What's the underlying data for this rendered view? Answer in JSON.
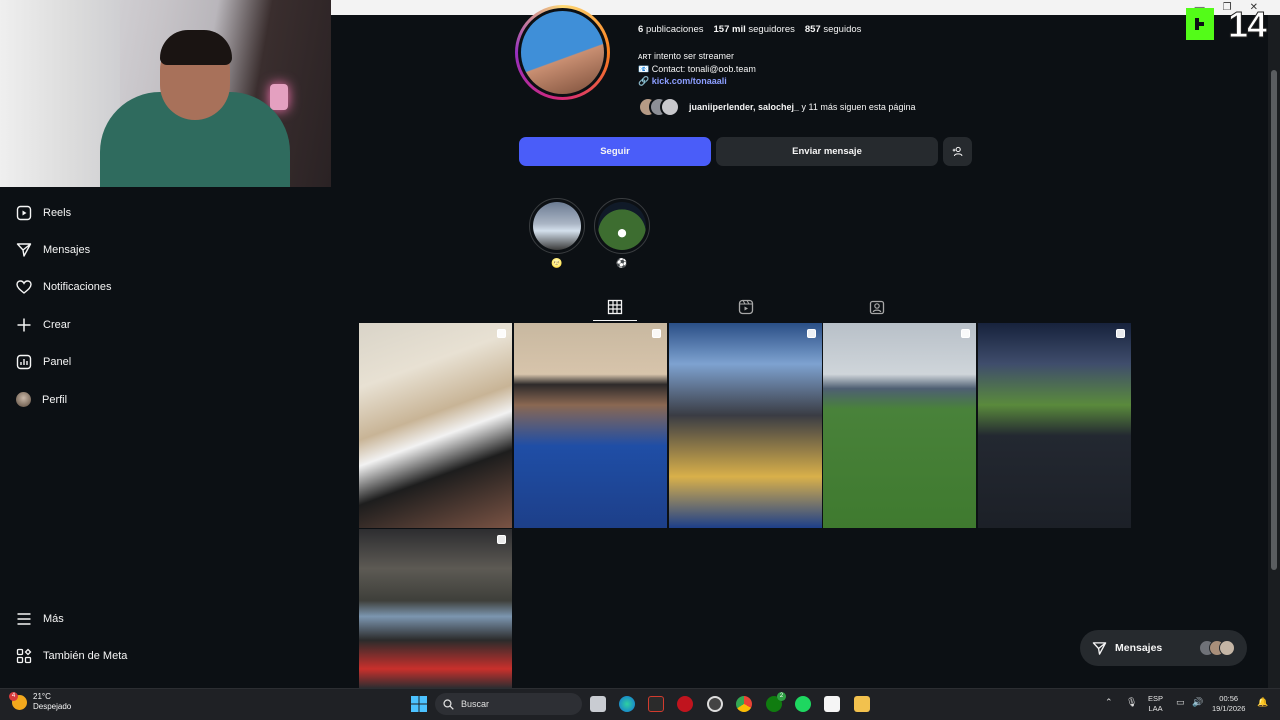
{
  "profile": {
    "stats": {
      "posts_num": "6",
      "posts_label": "publicaciones",
      "followers_num": "157 mil",
      "followers_label": "seguidores",
      "following_num": "857",
      "following_label": "seguidos"
    },
    "bio": {
      "line1": "ᴀʀᴛ intento ser streamer",
      "line2": "📧 Contact: tonali@oob.team",
      "link": "kick.com/tonaaali"
    },
    "followed_by": {
      "names": "juaniiperlender, salochej_",
      "rest": " y 11 más siguen esta página"
    },
    "follow_label": "Seguir",
    "message_label": "Enviar mensaje",
    "highlights": [
      {
        "label": "🌝"
      },
      {
        "label": "⚽"
      }
    ]
  },
  "sidebar": {
    "items": [
      {
        "label": "Reels",
        "icon": "reels-icon"
      },
      {
        "label": "Mensajes",
        "icon": "messages-icon"
      },
      {
        "label": "Notificaciones",
        "icon": "heart-icon"
      },
      {
        "label": "Crear",
        "icon": "plus-icon"
      },
      {
        "label": "Panel",
        "icon": "chart-icon"
      },
      {
        "label": "Perfil",
        "icon": "avatar"
      }
    ],
    "bottom": [
      {
        "label": "Más",
        "icon": "menu-icon"
      },
      {
        "label": "También de Meta",
        "icon": "meta-icon"
      }
    ]
  },
  "tabs": [
    "posts-grid-tab",
    "reels-tab",
    "tagged-tab"
  ],
  "floating_messages": {
    "label": "Mensajes"
  },
  "overlay": {
    "kick_number": "14"
  },
  "taskbar": {
    "weather_temp": "21°C",
    "weather_desc": "Despejado",
    "weather_badge": "4",
    "search_placeholder": "Buscar",
    "lang_top": "ESP",
    "lang_bottom": "LAA",
    "time": "00:56",
    "date": "19/1/2026",
    "xbox_badge": "2"
  },
  "colors": {
    "accent": "#4a5df9",
    "bg": "#0c1014",
    "kick_green": "#53fc18"
  }
}
